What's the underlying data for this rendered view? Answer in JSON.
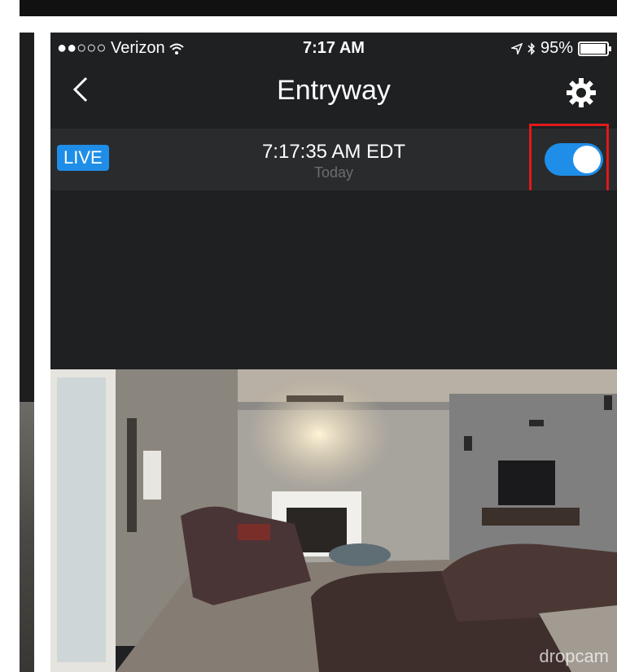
{
  "status_bar": {
    "carrier": "●●○○○ Verizon",
    "time": "7:17 AM",
    "battery": "95%",
    "battery_level": 0.95
  },
  "nav": {
    "title": "Entryway",
    "back_icon": "chevron-left-icon",
    "settings_icon": "gear-icon"
  },
  "info_bar": {
    "live_label": "LIVE",
    "time": "7:17:35 AM EDT",
    "date": "Today",
    "toggle_on": true
  },
  "camera_feed": {
    "watermark": "dropcam"
  },
  "colors": {
    "accent": "#1e8ee8",
    "background": "#1f2022",
    "highlight": "#e0191a"
  }
}
